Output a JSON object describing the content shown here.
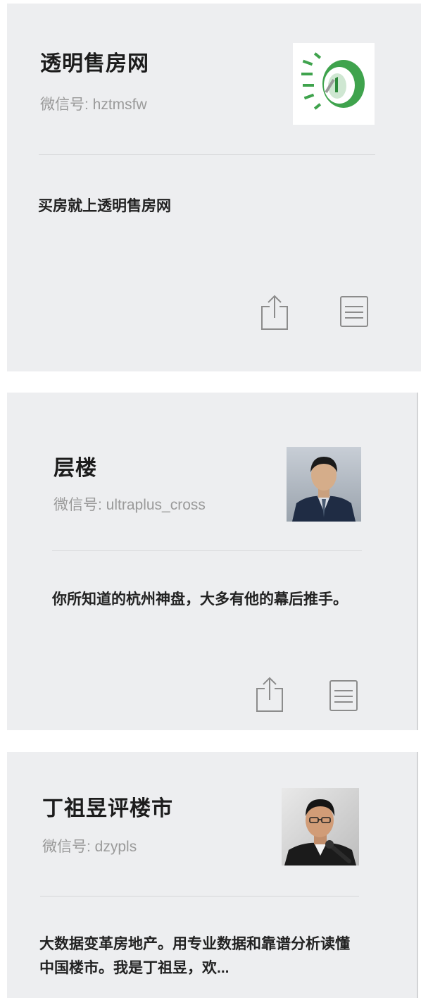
{
  "accounts": [
    {
      "name": "透明售房网",
      "wechat_id": "微信号: hztmsfw",
      "description": "买房就上透明售房网",
      "avatar": "clock-logo-icon"
    },
    {
      "name": "层楼",
      "wechat_id": "微信号: ultraplus_cross",
      "description": "你所知道的杭州神盘，大多有他的幕后推手。",
      "avatar": "man-in-suit-photo"
    },
    {
      "name": "丁祖昱评楼市",
      "wechat_id": "微信号: dzypls",
      "description": "大数据变革房地产。用专业数据和靠谱分析读懂中国楼市。我是丁祖昱，欢...",
      "avatar": "man-with-microphone-photo"
    }
  ],
  "icons": {
    "share": "share-icon",
    "profile": "document-icon"
  },
  "colors": {
    "card_background": "#edeef0",
    "logo_green": "#3fa34d",
    "text_primary": "#1c1c1c",
    "text_secondary": "#9a9a9a"
  }
}
